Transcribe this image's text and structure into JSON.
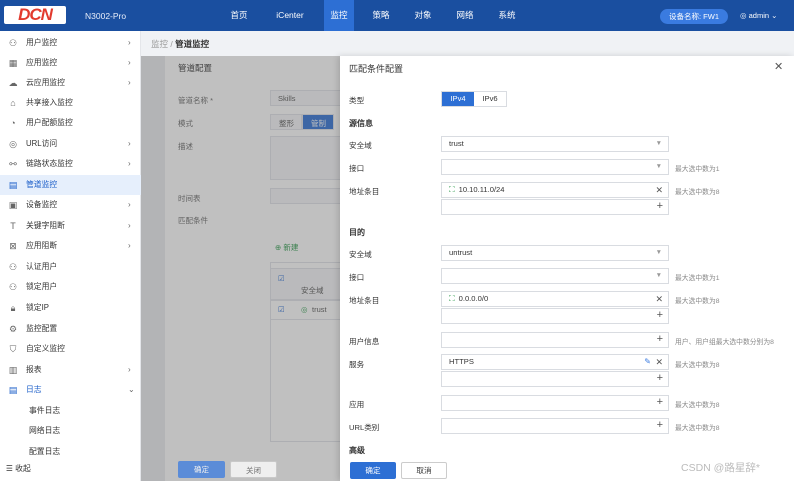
{
  "header": {
    "logo": "DCN",
    "model": "N3002-Pro",
    "nav": [
      "首页",
      "iCenter",
      "监控",
      "策略",
      "对象",
      "网络",
      "系统"
    ],
    "active_nav": "监控",
    "device": "设备名称: FW1",
    "user": "admin"
  },
  "sidebar": {
    "items": [
      {
        "label": "用户监控",
        "icon": "user-icon",
        "arrow": "›"
      },
      {
        "label": "应用监控",
        "icon": "app-icon",
        "arrow": "›"
      },
      {
        "label": "云应用监控",
        "icon": "cloud-icon",
        "arrow": "›"
      },
      {
        "label": "共享接入监控",
        "icon": "share-icon",
        "arrow": ""
      },
      {
        "label": "用户配额监控",
        "icon": "quota-icon",
        "arrow": ""
      },
      {
        "label": "URL访问",
        "icon": "url-icon",
        "arrow": "›"
      },
      {
        "label": "链路状态监控",
        "icon": "link-icon",
        "arrow": "›"
      },
      {
        "label": "管道监控",
        "icon": "pipe-icon",
        "arrow": ""
      },
      {
        "label": "设备监控",
        "icon": "device-icon",
        "arrow": "›"
      },
      {
        "label": "关键字阻断",
        "icon": "keyword-icon",
        "arrow": "›"
      },
      {
        "label": "应用阻断",
        "icon": "block-icon",
        "arrow": "›"
      },
      {
        "label": "认证用户",
        "icon": "auth-user-icon",
        "arrow": ""
      },
      {
        "label": "锁定用户",
        "icon": "lock-user-icon",
        "arrow": ""
      },
      {
        "label": "锁定IP",
        "icon": "lock-icon",
        "arrow": ""
      },
      {
        "label": "监控配置",
        "icon": "config-icon",
        "arrow": ""
      },
      {
        "label": "自定义监控",
        "icon": "custom-icon",
        "arrow": ""
      },
      {
        "label": "报表",
        "icon": "report-icon",
        "arrow": "›"
      },
      {
        "label": "日志",
        "icon": "log-icon",
        "arrow": "⌄"
      },
      {
        "label": "事件日志",
        "icon": "",
        "arrow": ""
      },
      {
        "label": "网络日志",
        "icon": "",
        "arrow": ""
      },
      {
        "label": "配置日志",
        "icon": "",
        "arrow": ""
      }
    ],
    "collapse": "收起"
  },
  "breadcrumb": {
    "parent": "监控",
    "current": "管道监控"
  },
  "background_form": {
    "title": "管道配置",
    "name_label": "管道名称 *",
    "name_value": "Skills",
    "mode_label": "模式",
    "mode_options": [
      "整形",
      "管制"
    ],
    "desc_label": "描述",
    "schedule_label": "时间表",
    "match_label": "匹配条件",
    "new_label": "新建",
    "col_zone": "安全域",
    "row_zone": "trust",
    "ok": "确定",
    "close": "关闭"
  },
  "drawer": {
    "title": "匹配条件配置",
    "type_label": "类型",
    "type_options": [
      "IPv4",
      "IPv6"
    ],
    "type_selected": "IPv4",
    "source": {
      "heading": "源信息",
      "zone_label": "安全域",
      "zone_value": "trust",
      "iface_label": "接口",
      "iface_hint": "最大选中数为1",
      "addr_label": "地址条目",
      "addr_value": "10.10.11.0/24",
      "addr_hint": "最大选中数为8"
    },
    "dest": {
      "heading": "目的",
      "zone_label": "安全域",
      "zone_value": "untrust",
      "iface_label": "接口",
      "iface_hint": "最大选中数为1",
      "addr_label": "地址条目",
      "addr_value": "0.0.0.0/0",
      "addr_hint": "最大选中数为8"
    },
    "user_label": "用户信息",
    "user_hint": "用户、用户组最大选中数分别为8",
    "service_label": "服务",
    "service_value": "HTTPS",
    "service_hint": "最大选中数为8",
    "app_label": "应用",
    "app_hint": "最大选中数为8",
    "url_label": "URL类别",
    "url_hint": "最大选中数为8",
    "advanced": "高级",
    "ok": "确定",
    "cancel": "取消"
  },
  "watermark": "CSDN @路星辞*",
  "colors": {
    "topbar": "#1a4fa0",
    "accent": "#2d6fd4",
    "active_bg": "#e6effc"
  }
}
